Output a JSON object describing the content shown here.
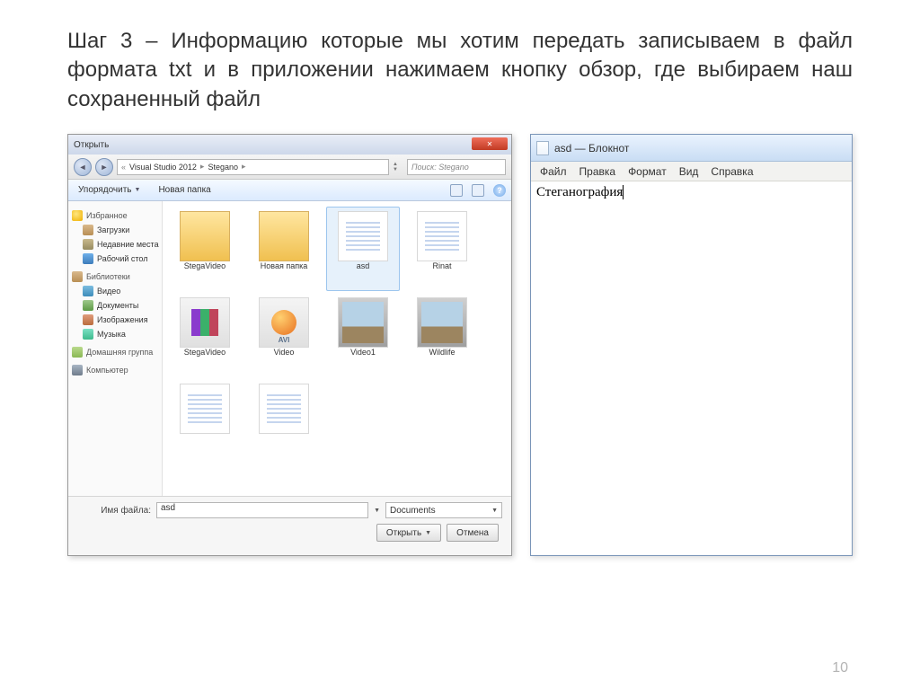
{
  "heading": "Шаг 3 – Информацию которые мы хотим передать записываем в файл формата txt и в приложении нажимаем кнопку обзор, где выбираем наш сохраненный файл",
  "page_number": "10",
  "file_dialog": {
    "title": "Открыть",
    "breadcrumb": {
      "sep": "«",
      "part1": "Visual Studio 2012",
      "part2": "Stegano"
    },
    "search_placeholder": "Поиск: Stegano",
    "toolbar": {
      "organize": "Упорядочить",
      "new_folder": "Новая папка"
    },
    "sidebar": {
      "favorites": "Избранное",
      "downloads": "Загрузки",
      "recent": "Недавние места",
      "desktop": "Рабочий стол",
      "libraries": "Библиотеки",
      "video": "Видео",
      "documents": "Документы",
      "images": "Изображения",
      "music": "Музыка",
      "homegroup": "Домашняя группа",
      "computer": "Компьютер"
    },
    "files": {
      "f1": "StegaVideo",
      "f2": "Новая папка",
      "f3": "asd",
      "f4": "Rinat",
      "f5": "StegaVideo",
      "f6": "Video",
      "f7": "Video1",
      "f8": "Wildlife"
    },
    "footer": {
      "filename_label": "Имя файла:",
      "filename_value": "asd",
      "filter": "Documents",
      "open": "Открыть",
      "cancel": "Отмена"
    }
  },
  "notepad": {
    "title": "asd — Блокнот",
    "menu": {
      "file": "Файл",
      "edit": "Правка",
      "format": "Формат",
      "view": "Вид",
      "help": "Справка"
    },
    "content": "Стеганография"
  }
}
